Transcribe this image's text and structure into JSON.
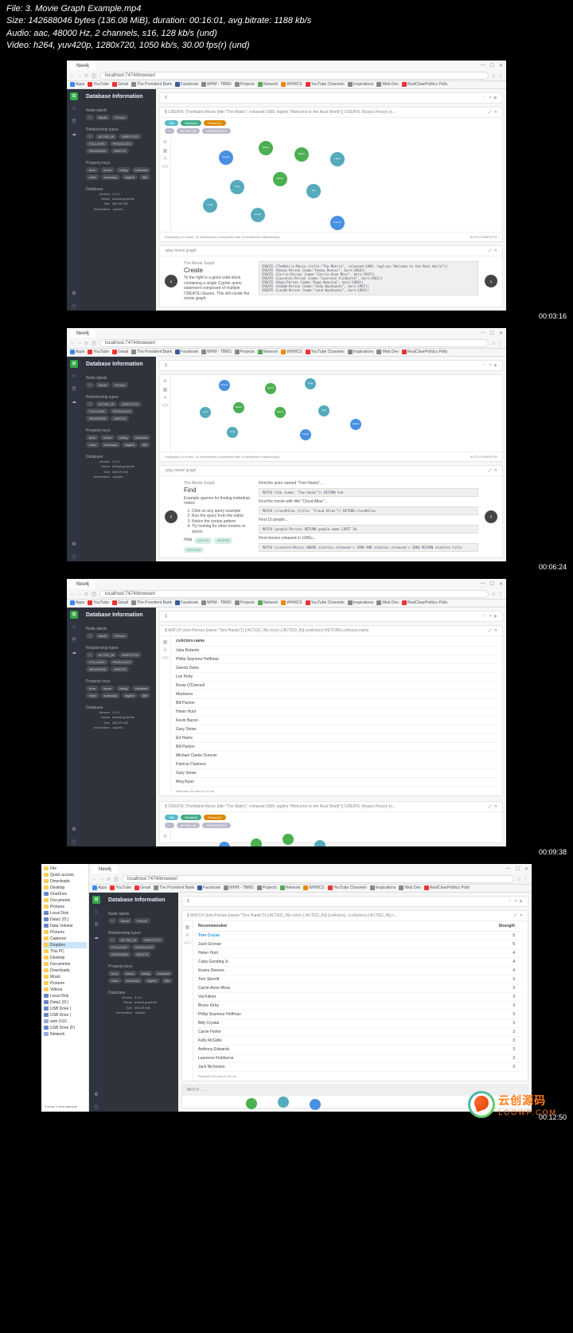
{
  "meta": {
    "file": "File: 3. Movie Graph Example.mp4",
    "size": "Size: 142688046 bytes (136.08 MiB), duration: 00:16:01, avg.bitrate: 1188 kb/s",
    "audio": "Audio: aac, 48000 Hz, 2 channels, s16, 128 kb/s (und)",
    "video": "Video: h264, yuv420p, 1280x720, 1050 kb/s, 30.00 fps(r) (und)"
  },
  "timestamps": [
    "",
    "00:03:16",
    "00:06:24",
    "00:09:38",
    "00:12:50"
  ],
  "browser": {
    "tab": "Neo4j",
    "url": "localhost:7474/browser/",
    "bookmarks": [
      "Apps",
      "YouTube",
      "Gmail",
      "The Provident Bank",
      "Facebook",
      "WHM - TBMS",
      "Projects",
      "Network",
      "WHMCS",
      "YouTube Channels",
      "Inspirations",
      "Web Dev",
      "RealClearPolitics Polls"
    ]
  },
  "sidebar": {
    "title": "Database Information",
    "labels_h": "Node labels",
    "labels": [
      "*",
      "Movie",
      "Person"
    ],
    "rels_h": "Relationship types",
    "rels": [
      "*",
      "ACTED_IN",
      "DIRECTED",
      "FOLLOWS",
      "PRODUCED",
      "REVIEWED",
      "WROTE"
    ],
    "props_h": "Property keys",
    "props": [
      "born",
      "name",
      "rating",
      "released",
      "roles",
      "summary",
      "tagline",
      "title"
    ],
    "db_h": "Database",
    "kv": [
      {
        "k": "Version",
        "v": "3.0.3"
      },
      {
        "k": "Name",
        "v": "default.graphdb"
      },
      {
        "k": "Size",
        "v": "389.29 KiB"
      },
      {
        "k": "Information",
        "v": ":sysinfo"
      }
    ]
  },
  "panel1": {
    "cmd": "$ CREATE (TheMatrix:Movie {title:\"The Matrix\", released:1999, tagline:\"Welcome to the Real World\"}) CREATE (Keanu:Person {n...",
    "pills": [
      "Title",
      "Movie(3)",
      "Person(7)"
    ],
    "pills2": [
      "*",
      "ACTED_IN",
      "DIRECTED(1)"
    ],
    "footer": "Displaying 10 nodes, 10 relationships (completed with 18 additional relationships).",
    "footer_r": "AUTO-COMPLETE"
  },
  "step1": {
    "label": ":play movie graph",
    "t1": "The Movie Graph",
    "t2": "Create",
    "desc": "To the right is a giant code block containing a single Cypher query statement composed of multiple CREATE clauses. This will create the movie graph.",
    "code": "CREATE (TheMatrix:Movie {title:\"The Matrix\", released:1999, tagline:\"Welcome to the Real World\"})\nCREATE (Keanu:Person {name:\"Keanu Reeves\", born:1964})\nCREATE (Carrie:Person {name:\"Carrie-Anne Moss\", born:1967})\nCREATE (Laurence:Person {name:\"Laurence Fishburne\", born:1961})\nCREATE (Hugo:Person {name:\"Hugo Weaving\", born:1960})\nCREATE (AndyW:Person {name:\"Andy Wachowski\", born:1967})\nCREATE (LanaW:Person {name:\"Lana Wachowski\", born:1965})"
  },
  "step2": {
    "label": ":play movie graph",
    "t1": "The Movie Graph",
    "t2": "Find",
    "desc": "Example queries for finding individual nodes.",
    "ol": [
      "Click on any query example",
      "Run the query from the editor",
      "Notice the syntax pattern",
      "Try looking for other movies or actors"
    ],
    "help": "Help",
    "help_pills": [
      "MATCH",
      "WHERE",
      "RETURN"
    ],
    "queries": [
      {
        "l": "Find the actor named \"Tom Hanks\"...",
        "c": "MATCH (tom {name: \"Tom Hanks\"}) RETURN tom"
      },
      {
        "l": "Find the movie with title \"Cloud Atlas\"...",
        "c": "MATCH (cloudAtlas {title: \"Cloud Atlas\"}) RETURN cloudAtlas"
      },
      {
        "l": "Find 10 people...",
        "c": "MATCH (people:Person) RETURN people.name LIMIT 10"
      },
      {
        "l": "Find movies released in 1990s...",
        "c": "MATCH (nineties:Movie) WHERE nineties.released > 1990 AND nineties.released < 2000 RETURN nineties.title"
      }
    ]
  },
  "table1": {
    "cmd": "$ MATCH (tom:Person {name:\"Tom Hanks\"})-[:ACTED_IN]->(m)<-[:ACTED_IN]-(coActors) RETURN coActors.name",
    "header": "coActors.name",
    "rows": [
      "Julia Roberts",
      "Philip Seymour Hoffman",
      "Geena Davis",
      "Lori Petty",
      "Rosie O'Donnell",
      "Madonna",
      "Bill Paxton",
      "Helen Hunt",
      "Kevin Bacon",
      "Gary Sinise",
      "Ed Harris",
      "Bill Paxton",
      "Michael Clarke Duncan",
      "Patricia Clarkson",
      "Gary Sinise",
      "Meg Ryan"
    ],
    "sum": "Returned 30 rows in 13 ms."
  },
  "table2": {
    "cmd": "$ MATCH (tom:Person {name:\"Tom Hanks\"})-[:ACTED_IN]->(m)<-[:ACTED_IN]-(coActors), (coActors)-[:ACTED_IN]->...",
    "h1": "Recommended",
    "h2": "Strength",
    "rows": [
      {
        "n": "Tom Cruise",
        "s": "5"
      },
      {
        "n": "Zach Grenier",
        "s": "5"
      },
      {
        "n": "Helen Hunt",
        "s": "4"
      },
      {
        "n": "Cuba Gooding Jr.",
        "s": "4"
      },
      {
        "n": "Keanu Reeves",
        "s": "4"
      },
      {
        "n": "Tom Skerritt",
        "s": "3"
      },
      {
        "n": "Carrie-Anne Moss",
        "s": "3"
      },
      {
        "n": "Val Kilmer",
        "s": "3"
      },
      {
        "n": "Bruno Kirby",
        "s": "3"
      },
      {
        "n": "Philip Seymour Hoffman",
        "s": "3"
      },
      {
        "n": "Billy Crystal",
        "s": "3"
      },
      {
        "n": "Carrie Fisher",
        "s": "3"
      },
      {
        "n": "Kelly McGillis",
        "s": "3"
      },
      {
        "n": "Anthony Edwards",
        "s": "3"
      },
      {
        "n": "Laurence Fishburne",
        "s": "3"
      },
      {
        "n": "Jack Nicholson",
        "s": "3"
      }
    ],
    "sum": "Returned 50 rows in 28 ms."
  },
  "fe": {
    "top": [
      "File",
      "Quick access",
      "Downloads",
      "Desktop",
      "OneDrive",
      "Documents",
      "Pictures",
      "Local Disk",
      "Data1 (D:)",
      "Data Volume",
      "Pictures",
      "Captures",
      "Dropbox",
      "This PC",
      "Desktop",
      "Documents",
      "Downloads",
      "Music",
      "Pictures",
      "Videos",
      "Local Disk",
      "Data1 (D:)",
      "USB Drive (",
      "USB Drive (",
      "web (\\\\10.",
      "USB Drive (F)",
      "Network"
    ],
    "sel": "Dropbox",
    "status": "2 items   1 item selected"
  },
  "watermark": {
    "main": "云创源码",
    "sub": "LOOWP.COM"
  }
}
